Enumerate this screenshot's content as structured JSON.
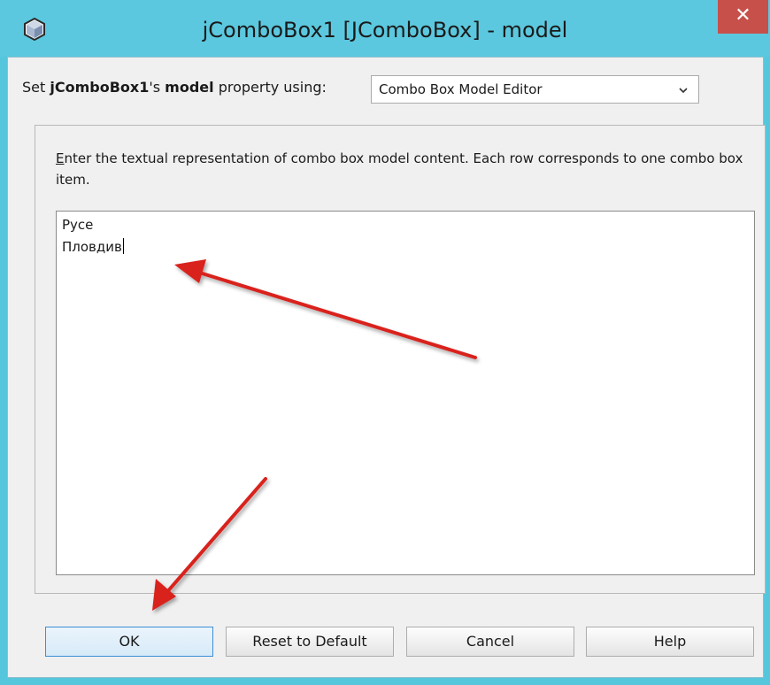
{
  "window": {
    "title": "jComboBox1 [JComboBox] - model",
    "close_glyph": "✕"
  },
  "property_row": {
    "prefix": "Set ",
    "component": "jComboBox1",
    "possessive": "'s ",
    "property": "model",
    "suffix": " property using:"
  },
  "editor_combo": {
    "selected": "Combo Box Model Editor",
    "icon": "chevron-down-icon"
  },
  "editor": {
    "mnemonic": "E",
    "instructions_rest": "nter the textual representation of combo box model content. Each row corresponds to one combo box item.",
    "lines": [
      "Русе",
      "Пловдив"
    ]
  },
  "buttons": {
    "ok": "OK",
    "reset": "Reset to Default",
    "cancel": "Cancel",
    "help": "Help"
  },
  "colors": {
    "titlebar": "#5bc8df",
    "close": "#c7504b",
    "annotation_arrow": "#d9201e"
  }
}
